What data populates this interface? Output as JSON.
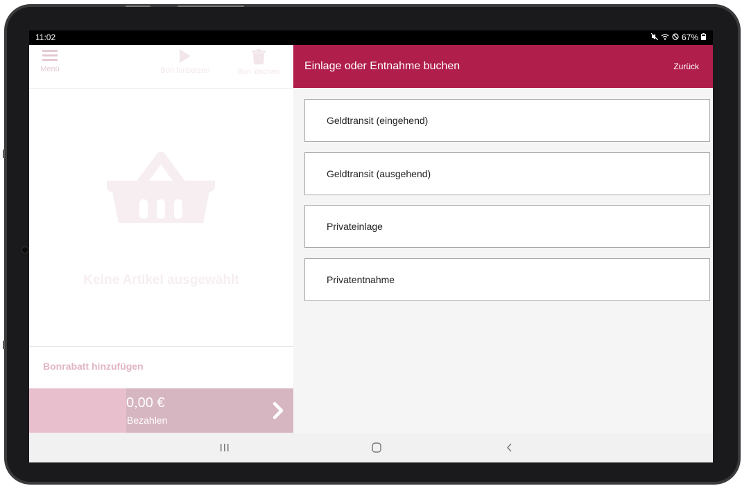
{
  "statusbar": {
    "time": "11:02",
    "battery": "67%"
  },
  "toolbar": {
    "menu_label": "Menü",
    "continue_label": "Bon fortsetzen",
    "delete_label": "Bon löschen"
  },
  "basket": {
    "empty_text": "Keine Artikel ausgewählt"
  },
  "discount": {
    "label": "Bonrabatt hinzufügen"
  },
  "pay": {
    "amount": "0,00 €",
    "label": "Bezahlen"
  },
  "panel": {
    "title": "Einlage oder Entnahme buchen",
    "back_label": "Zurück",
    "options": [
      {
        "label": "Geldtransit (eingehend)"
      },
      {
        "label": "Geldtransit (ausgehend)"
      },
      {
        "label": "Privateinlage"
      },
      {
        "label": "Privatentnahme"
      }
    ]
  },
  "colors": {
    "accent": "#b01e4c",
    "pay_left": "#e8bfcc",
    "pay_right": "#d6b6c0"
  }
}
